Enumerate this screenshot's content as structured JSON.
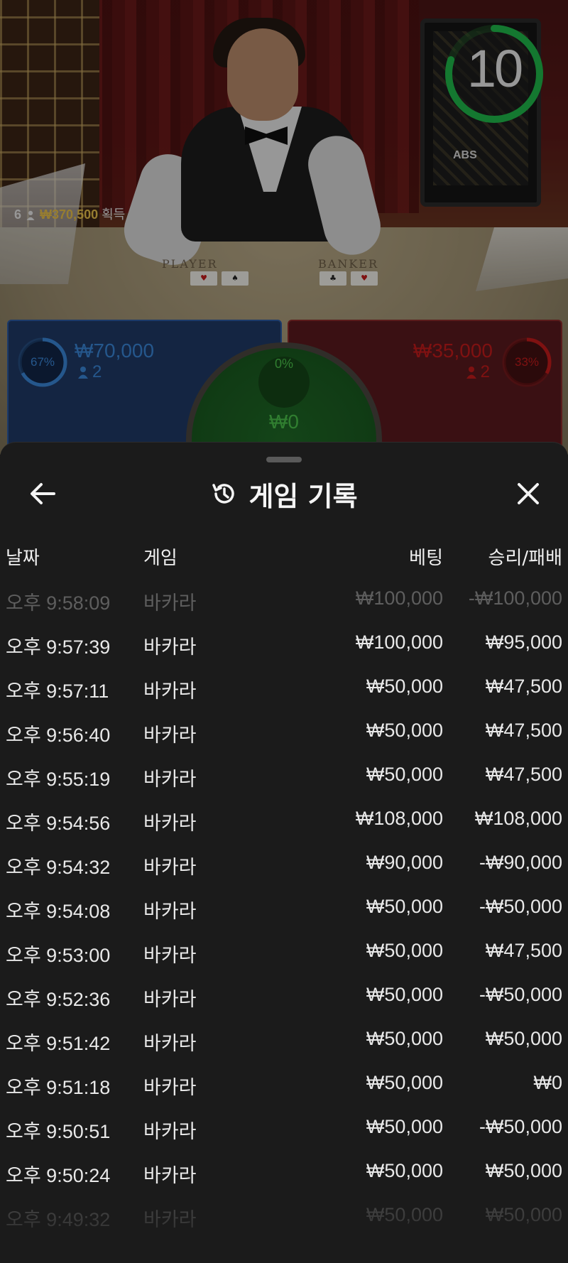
{
  "live": {
    "timer_value": "10",
    "timer_fraction": 0.8,
    "monitor_logo": "ABS",
    "winners_count": "6",
    "winners_amount": "₩370,500",
    "winners_label": "획득",
    "table_left_word": "PLAYER",
    "table_right_word": "BANKER"
  },
  "bets": {
    "player": {
      "pct": "67%",
      "pct_value": 0.67,
      "amount": "₩70,000",
      "count": "2",
      "color": "#3a86d8"
    },
    "banker": {
      "pct": "33%",
      "pct_value": 0.33,
      "amount": "₩35,000",
      "count": "2",
      "color": "#c41b1b"
    },
    "tie": {
      "pct": "0%",
      "amount": "₩0",
      "color": "#4ac24a"
    }
  },
  "history": {
    "title": "게임 기록",
    "back_icon": "arrow-left-icon",
    "title_icon": "history-icon",
    "close_icon": "close-icon",
    "columns": {
      "date": "날짜",
      "game": "게임",
      "bet": "베팅",
      "result": "승리/패배"
    },
    "rows": [
      {
        "date": "오후 9:58:09",
        "game": "바카라",
        "bet": "₩100,000",
        "result": "-₩100,000"
      },
      {
        "date": "오후 9:57:39",
        "game": "바카라",
        "bet": "₩100,000",
        "result": "₩95,000"
      },
      {
        "date": "오후 9:57:11",
        "game": "바카라",
        "bet": "₩50,000",
        "result": "₩47,500"
      },
      {
        "date": "오후 9:56:40",
        "game": "바카라",
        "bet": "₩50,000",
        "result": "₩47,500"
      },
      {
        "date": "오후 9:55:19",
        "game": "바카라",
        "bet": "₩50,000",
        "result": "₩47,500"
      },
      {
        "date": "오후 9:54:56",
        "game": "바카라",
        "bet": "₩108,000",
        "result": "₩108,000"
      },
      {
        "date": "오후 9:54:32",
        "game": "바카라",
        "bet": "₩90,000",
        "result": "-₩90,000"
      },
      {
        "date": "오후 9:54:08",
        "game": "바카라",
        "bet": "₩50,000",
        "result": "-₩50,000"
      },
      {
        "date": "오후 9:53:00",
        "game": "바카라",
        "bet": "₩50,000",
        "result": "₩47,500"
      },
      {
        "date": "오후 9:52:36",
        "game": "바카라",
        "bet": "₩50,000",
        "result": "-₩50,000"
      },
      {
        "date": "오후 9:51:42",
        "game": "바카라",
        "bet": "₩50,000",
        "result": "₩50,000"
      },
      {
        "date": "오후 9:51:18",
        "game": "바카라",
        "bet": "₩50,000",
        "result": "₩0"
      },
      {
        "date": "오후 9:50:51",
        "game": "바카라",
        "bet": "₩50,000",
        "result": "-₩50,000"
      },
      {
        "date": "오후 9:50:24",
        "game": "바카라",
        "bet": "₩50,000",
        "result": "₩50,000"
      },
      {
        "date": "오후 9:49:32",
        "game": "바카라",
        "bet": "₩50,000",
        "result": "₩50,000"
      }
    ]
  }
}
